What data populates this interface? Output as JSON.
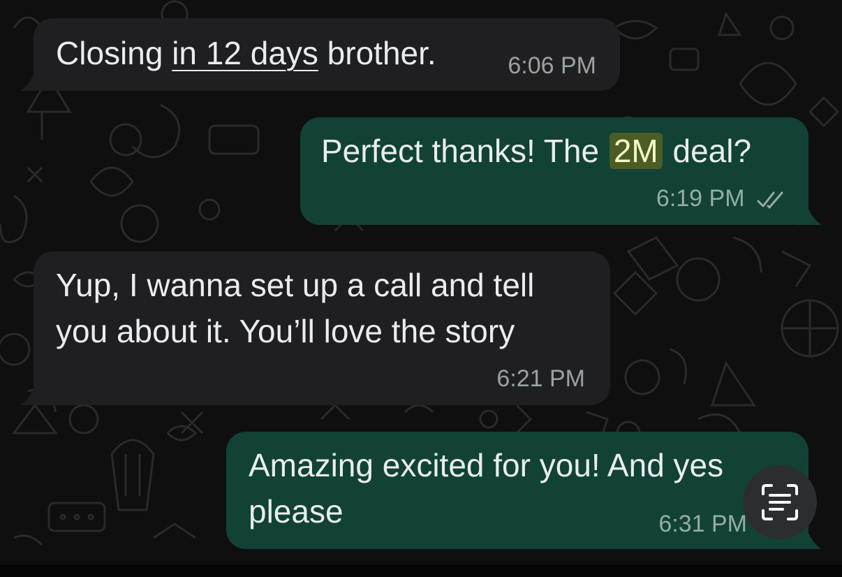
{
  "colors": {
    "background": "#0f0f0f",
    "incoming_bubble": "#1f1f21",
    "outgoing_bubble": "#124235",
    "message_text": "#e9edef",
    "highlight_bg": "#4b5d24",
    "read_ticks": "#95ada4"
  },
  "messages": [
    {
      "direction": "incoming",
      "text_before": "Closing ",
      "link_text": "in 12 days",
      "text_after": " brother.",
      "time": "6:06 PM"
    },
    {
      "direction": "outgoing",
      "text_before": "Perfect thanks! The ",
      "highlight_text": "2M",
      "text_after": " deal?",
      "time": "6:19 PM",
      "status_icon": "double-check-read-icon"
    },
    {
      "direction": "incoming",
      "line1": "Yup, I wanna set up a call and tell",
      "line2": "you about it. You’ll love the story",
      "time": "6:21 PM"
    },
    {
      "direction": "outgoing",
      "line1": "Amazing excited for you! And yes",
      "line2": "please",
      "time": "6:31 PM"
    }
  ],
  "floating_button": {
    "icon": "text-scan-icon"
  }
}
